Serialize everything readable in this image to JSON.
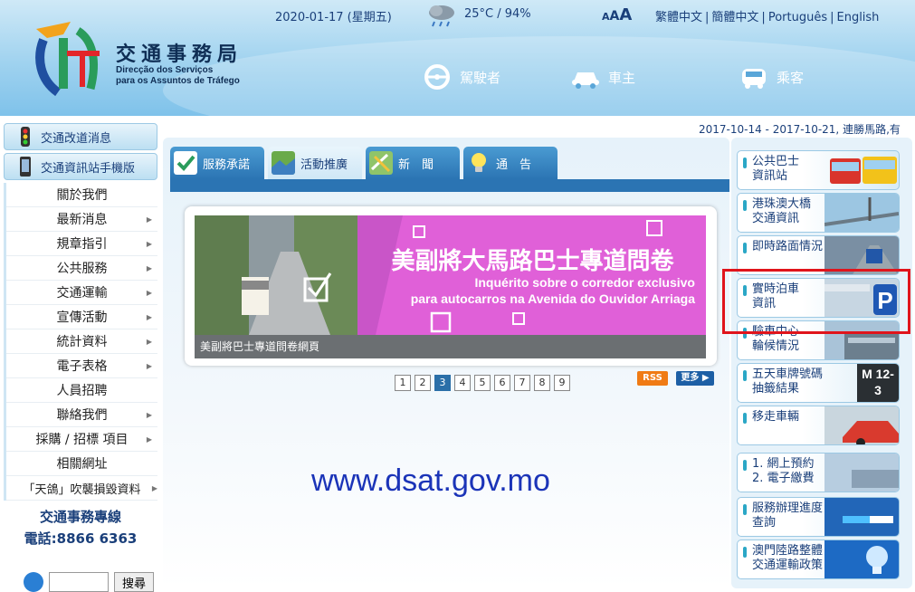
{
  "header": {
    "date": "2020-01-17 (星期五)",
    "weather": "25°C / 94%",
    "font_size_controls": [
      "A",
      "A",
      "A"
    ],
    "languages": [
      "繁體中文",
      "簡體中文",
      "Português",
      "English"
    ],
    "logo_cn": "交通事務局",
    "logo_pt_1": "Direcção dos Serviços",
    "logo_pt_2": "para os Assuntos de Tráfego",
    "nav": [
      {
        "label": "駕駛者",
        "icon": "steering-wheel-icon"
      },
      {
        "label": "車主",
        "icon": "car-icon"
      },
      {
        "label": "乘客",
        "icon": "bus-icon"
      }
    ]
  },
  "ticker": "2017-10-14 - 2017-10-21, 連勝馬路,有",
  "sidebar": {
    "top_buttons": [
      "交通改道消息",
      "交通資訊站手機版"
    ],
    "menu": [
      {
        "label": "關於我們",
        "arrow": false
      },
      {
        "label": "最新消息",
        "arrow": true
      },
      {
        "label": "規章指引",
        "arrow": true
      },
      {
        "label": "公共服務",
        "arrow": true
      },
      {
        "label": "交通運輸",
        "arrow": true
      },
      {
        "label": "宣傳活動",
        "arrow": true
      },
      {
        "label": "統計資料",
        "arrow": true
      },
      {
        "label": "電子表格",
        "arrow": true
      },
      {
        "label": "人員招聘",
        "arrow": false
      },
      {
        "label": "聯絡我們",
        "arrow": true
      },
      {
        "label": "採購 / 招標 項目",
        "arrow": true
      },
      {
        "label": "相關網址",
        "arrow": false
      },
      {
        "label": "「天鴿」吹襲損毀資料",
        "arrow": true
      }
    ],
    "hotline_title": "交通事務專線",
    "hotline_phone": "電話:8866 6363",
    "search_button": "搜尋",
    "search_placeholder": ""
  },
  "tabs": [
    {
      "label": "服務承諾",
      "active": false
    },
    {
      "label": "活動推廣",
      "active": true
    },
    {
      "label": "新　聞",
      "active": false
    },
    {
      "label": "通　告",
      "active": false
    }
  ],
  "banner": {
    "title": "美副將大馬路巴士專道問卷",
    "subtitle_1": "Inquérito sobre o corredor exclusivo",
    "subtitle_2": "para autocarros na Avenida do Ouvidor Arriaga",
    "caption": "美副將巴士專道問卷網頁"
  },
  "pager": {
    "pages": [
      "1",
      "2",
      "3",
      "4",
      "5",
      "6",
      "7",
      "8",
      "9"
    ],
    "current": 3
  },
  "rss_label": "RSS",
  "more_label": "更多",
  "watermark": "www.dsat.gov.mo",
  "right_panel": [
    {
      "label": "公共巴士\n資訊站"
    },
    {
      "label": "港珠澳大橋\n交通資訊"
    },
    {
      "label": "即時路面情況"
    },
    {
      "label": "實時泊車\n資訊"
    },
    {
      "label": "驗車中心\n輪候情況"
    },
    {
      "label": "五天車牌號碼\n抽籤結果"
    },
    {
      "label": "移走車輛"
    },
    {
      "label": "1. 網上預約\n2. 電子繳費"
    },
    {
      "label": "服務辦理進度\n查詢"
    },
    {
      "label": "澳門陸路整體\n交通運輸政策"
    }
  ],
  "right_panel_badge": "M 12-3",
  "colors": {
    "accent": "#2b74b3",
    "banner_magenta": "#e060d8",
    "highlight": "#e0141b"
  }
}
